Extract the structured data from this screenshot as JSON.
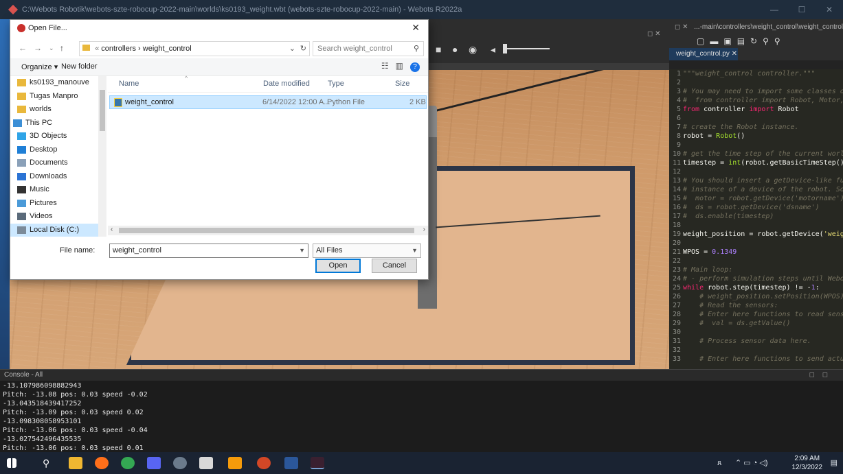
{
  "window": {
    "title": "C:\\Webots Robotik\\webots-szte-robocup-2022-main\\worlds\\ks0193_weight.wbt (webots-szte-robocup-2022-main) - Webots R2022a"
  },
  "editor": {
    "path": "...-main\\controllers\\weight_control\\weight_control.py",
    "tab": "weight_control.py",
    "lines": [
      {
        "n": "1",
        "html": "<span class=\"c-comment\">\"\"\"weight_control controller.\"\"\"</span>"
      },
      {
        "n": "2",
        "html": ""
      },
      {
        "n": "3",
        "html": "<span class=\"c-comment\"># You may need to import some classes of</span>"
      },
      {
        "n": "4",
        "html": "<span class=\"c-comment\">#  from controller import Robot, Motor, D</span>"
      },
      {
        "n": "5",
        "html": "<span class=\"c-kw\">from</span> controller <span class=\"c-kw\">import</span> Robot"
      },
      {
        "n": "6",
        "html": ""
      },
      {
        "n": "7",
        "html": "<span class=\"c-comment\"># create the Robot instance.</span>"
      },
      {
        "n": "8",
        "html": "robot = <span class=\"c-fn\">Robot</span>()"
      },
      {
        "n": "9",
        "html": ""
      },
      {
        "n": "10",
        "html": "<span class=\"c-comment\"># get the time step of the current world.</span>"
      },
      {
        "n": "11",
        "html": "timestep = <span class=\"c-fn\">int</span>(robot.getBasicTimeStep())"
      },
      {
        "n": "12",
        "html": ""
      },
      {
        "n": "13",
        "html": "<span class=\"c-comment\"># You should insert a getDevice-like func</span>"
      },
      {
        "n": "14",
        "html": "<span class=\"c-comment\"># instance of a device of the robot. Some</span>"
      },
      {
        "n": "15",
        "html": "<span class=\"c-comment\">#  motor = robot.getDevice('motorname')</span>"
      },
      {
        "n": "16",
        "html": "<span class=\"c-comment\">#  ds = robot.getDevice('dsname')</span>"
      },
      {
        "n": "17",
        "html": "<span class=\"c-comment\">#  ds.enable(timestep)</span>"
      },
      {
        "n": "18",
        "html": ""
      },
      {
        "n": "19",
        "html": "weight_position = robot.getDevice(<span class=\"c-str\">'weight</span>"
      },
      {
        "n": "20",
        "html": ""
      },
      {
        "n": "21",
        "html": "WPOS = <span class=\"c-num\">0.1349</span>"
      },
      {
        "n": "22",
        "html": ""
      },
      {
        "n": "23",
        "html": "<span class=\"c-comment\"># Main loop:</span>"
      },
      {
        "n": "24",
        "html": "<span class=\"c-comment\"># - perform simulation steps until Webots</span>"
      },
      {
        "n": "25",
        "html": "<span class=\"c-kw\">while</span> robot.step(timestep) != -<span class=\"c-num\">1</span>:"
      },
      {
        "n": "26",
        "html": "    <span class=\"c-comment\"># weight_position.setPosition(WPOS)</span>"
      },
      {
        "n": "27",
        "html": "    <span class=\"c-comment\"># Read the sensors:</span>"
      },
      {
        "n": "28",
        "html": "    <span class=\"c-comment\"># Enter here functions to read sensor</span>"
      },
      {
        "n": "29",
        "html": "    <span class=\"c-comment\">#  val = ds.getValue()</span>"
      },
      {
        "n": "30",
        "html": ""
      },
      {
        "n": "31",
        "html": "    <span class=\"c-comment\"># Process sensor data here.</span>"
      },
      {
        "n": "32",
        "html": ""
      },
      {
        "n": "33",
        "html": "    <span class=\"c-comment\"># Enter here functions to send actua</span>"
      }
    ]
  },
  "console": {
    "title": "Console - All",
    "lines": [
      "-13.107986098882943",
      "Pitch: -13.08 pos: 0.03 speed -0.02",
      "-13.043518439417252",
      "Pitch: -13.09 pos: 0.03 speed 0.02",
      "-13.098308058953101",
      "Pitch: -13.06 pos: 0.03 speed -0.04",
      "-13.027542496435535",
      "Pitch: -13.06 pos: 0.03 speed 0.01"
    ]
  },
  "dialog": {
    "title": "Open File...",
    "close_glyph": "✕",
    "path_prefix": "«",
    "path": "controllers  ›  weight_control",
    "search_placeholder": "Search weight_control",
    "organize": "Organize ▾",
    "new_folder": "New folder",
    "tree": [
      {
        "label": "ks0193_manouve",
        "icon": "folder-icon",
        "color": "#e9b83c"
      },
      {
        "label": "Tugas Manpro",
        "icon": "folder-icon",
        "color": "#e9b83c"
      },
      {
        "label": "worlds",
        "icon": "folder-icon",
        "color": "#e9b83c"
      },
      {
        "label": "This PC",
        "icon": "computer-icon",
        "color": "#3c8fd6"
      },
      {
        "label": "3D Objects",
        "icon": "cube-icon",
        "color": "#2fa4e7"
      },
      {
        "label": "Desktop",
        "icon": "desktop-icon",
        "color": "#1f7fd6"
      },
      {
        "label": "Documents",
        "icon": "documents-icon",
        "color": "#8aa0b8"
      },
      {
        "label": "Downloads",
        "icon": "download-icon",
        "color": "#2b73d4"
      },
      {
        "label": "Music",
        "icon": "music-icon",
        "color": "#333333"
      },
      {
        "label": "Pictures",
        "icon": "pictures-icon",
        "color": "#4a9ad8"
      },
      {
        "label": "Videos",
        "icon": "videos-icon",
        "color": "#5a6a7a"
      },
      {
        "label": "Local Disk (C:)",
        "icon": "disk-icon",
        "color": "#7b8a99"
      }
    ],
    "columns": {
      "name": "Name",
      "date": "Date modified",
      "type": "Type",
      "size": "Size"
    },
    "file": {
      "name": "weight_control",
      "date": "6/14/2022 12:00 A...",
      "type": "Python File",
      "size": "2 KB"
    },
    "filename_label": "File name:",
    "filename_value": "weight_control",
    "filter_value": "All Files",
    "open_label": "Open",
    "cancel_label": "Cancel"
  },
  "taskbar": {
    "time": "2:09 AM",
    "date": "12/3/2022"
  }
}
